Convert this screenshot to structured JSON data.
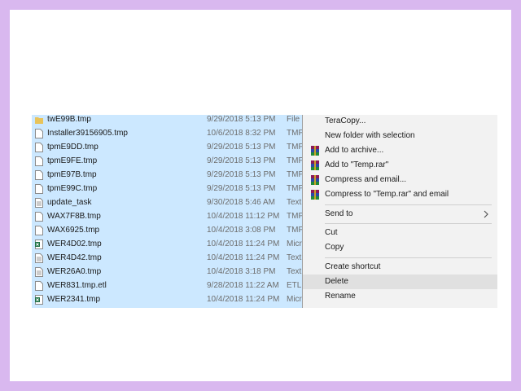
{
  "files": [
    {
      "name": "twE99B.tmp",
      "date": "9/29/2018 5:13 PM",
      "type": "File",
      "icon": "folder-icon"
    },
    {
      "name": "Installer39156905.tmp",
      "date": "10/6/2018 8:32 PM",
      "type": "TMP",
      "icon": "file-icon"
    },
    {
      "name": "tpmE9DD.tmp",
      "date": "9/29/2018 5:13 PM",
      "type": "TMP",
      "icon": "file-icon"
    },
    {
      "name": "tpmE9FE.tmp",
      "date": "9/29/2018 5:13 PM",
      "type": "TMP",
      "icon": "file-icon"
    },
    {
      "name": "tpmE97B.tmp",
      "date": "9/29/2018 5:13 PM",
      "type": "TMP",
      "icon": "file-icon"
    },
    {
      "name": "tpmE99C.tmp",
      "date": "9/29/2018 5:13 PM",
      "type": "TMP",
      "icon": "file-icon"
    },
    {
      "name": "update_task",
      "date": "9/30/2018 5:46 AM",
      "type": "Text",
      "icon": "text-file-icon"
    },
    {
      "name": "WAX7F8B.tmp",
      "date": "10/4/2018 11:12 PM",
      "type": "TMP",
      "icon": "file-icon"
    },
    {
      "name": "WAX6925.tmp",
      "date": "10/4/2018 3:08 PM",
      "type": "TMP",
      "icon": "file-icon"
    },
    {
      "name": "WER4D02.tmp",
      "date": "10/4/2018 11:24 PM",
      "type": "Micr",
      "icon": "excel-file-icon"
    },
    {
      "name": "WER4D42.tmp",
      "date": "10/4/2018 11:24 PM",
      "type": "Text",
      "icon": "text-file-icon"
    },
    {
      "name": "WER26A0.tmp",
      "date": "10/4/2018 3:18 PM",
      "type": "Text",
      "icon": "text-file-icon"
    },
    {
      "name": "WER831.tmp.etl",
      "date": "9/28/2018 11:22 AM",
      "type": "ETL",
      "icon": "file-icon"
    },
    {
      "name": "WER2341.tmp",
      "date": "10/4/2018 11:24 PM",
      "type": "Micr",
      "icon": "excel-file-icon"
    }
  ],
  "context_menu": {
    "teracopy": "TeraCopy...",
    "new_folder": "New folder with selection",
    "add_archive": "Add to archive...",
    "add_temp_rar": "Add to \"Temp.rar\"",
    "compress_email": "Compress and email...",
    "compress_temp_email": "Compress to \"Temp.rar\" and email",
    "send_to": "Send to",
    "cut": "Cut",
    "copy": "Copy",
    "create_shortcut": "Create shortcut",
    "delete": "Delete",
    "rename": "Rename"
  },
  "colors": {
    "page_border": "#d9b8ef",
    "selection": "#cce8ff",
    "menu_bg": "#f2f2f2",
    "menu_highlight": "#e0e0e0"
  }
}
